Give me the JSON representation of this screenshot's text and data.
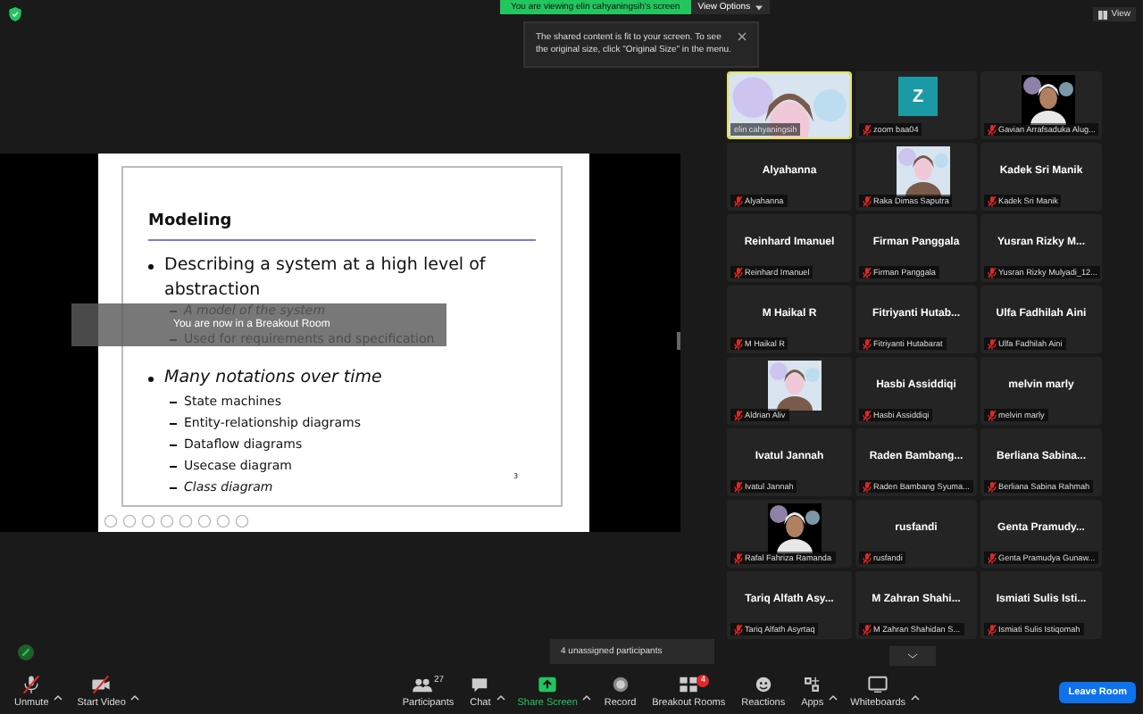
{
  "banner": {
    "text": "You are viewing elin cahyaningsih's screen",
    "button": "View Options"
  },
  "view_button": "View",
  "tooltip": "The shared content is fit to your screen. To see the original size, click \"Original Size\" in the menu.",
  "slide": {
    "title": "Modeling",
    "page": "3",
    "bullets": [
      {
        "text": "Describing a system at a high level of abstraction",
        "italic": false,
        "children": [
          {
            "text": "A model of the system",
            "italic": true
          },
          {
            "text": "Used for requirements and specification",
            "italic": false
          }
        ]
      },
      {
        "text": "Many notations over time",
        "italic": true,
        "children": [
          {
            "text": "State machines",
            "italic": false
          },
          {
            "text": "Entity-relationship diagrams",
            "italic": false
          },
          {
            "text": "Dataflow diagrams",
            "italic": false
          },
          {
            "text": "Usecase diagram",
            "italic": false
          },
          {
            "text": "Class diagram",
            "italic": true
          }
        ]
      }
    ]
  },
  "breakout_notice": "You are now in a Breakout Room",
  "tiles": [
    {
      "kind": "video",
      "label": "elin cahyaningsih",
      "muted": false,
      "speaking": true
    },
    {
      "kind": "avatar",
      "initial": "Z",
      "color": "#1b9aa5",
      "label": "zoom baa04",
      "muted": true,
      "speaking": false
    },
    {
      "label": "Gavian Arrafsaduka Alug...",
      "muted": true,
      "speaking": false
    },
    {
      "kind": "name",
      "name": "Alyahanna",
      "label": "Alyahanna",
      "muted": true,
      "speaking": false
    },
    {
      "label": "Raka Dimas Saputra",
      "muted": true,
      "speaking": false
    },
    {
      "kind": "name",
      "name": "Kadek Sri Manik",
      "label": "Kadek Sri Manik",
      "muted": true,
      "speaking": false
    },
    {
      "kind": "name",
      "name": "Reinhard Imanuel",
      "label": "Reinhard Imanuel",
      "muted": true,
      "speaking": false
    },
    {
      "kind": "name",
      "name": "Firman Panggala",
      "label": "Firman Panggala",
      "muted": true,
      "speaking": false
    },
    {
      "kind": "name",
      "name": "Yusran Rizky M...",
      "label": "Yusran Rizky Mulyadi_12...",
      "muted": true,
      "speaking": false
    },
    {
      "kind": "name",
      "name": "M Haikal R",
      "label": "M Haikal R",
      "muted": true,
      "speaking": false
    },
    {
      "kind": "name",
      "name": "Fitriyanti Hutab...",
      "label": "Fitriyanti Hutabarat",
      "muted": true,
      "speaking": false
    },
    {
      "kind": "name",
      "name": "Ulfa Fadhilah Aini",
      "label": "Ulfa Fadhilah Aini",
      "muted": true,
      "speaking": false
    },
    {
      "label": "Aldrian Aliv",
      "muted": true,
      "speaking": false
    },
    {
      "kind": "name",
      "name": "Hasbi Assiddiqi",
      "label": "Hasbi Assiddiqi",
      "muted": true,
      "speaking": false
    },
    {
      "kind": "name",
      "name": "melvin marly",
      "label": "melvin marly",
      "muted": true,
      "speaking": false
    },
    {
      "kind": "name",
      "name": "Ivatul Jannah",
      "label": "Ivatul Jannah",
      "muted": true,
      "speaking": false
    },
    {
      "kind": "name",
      "name": "Raden Bambang...",
      "label": "Raden Bambang Syuma...",
      "muted": true,
      "speaking": false
    },
    {
      "kind": "name",
      "name": "Berliana Sabina...",
      "label": "Berliana Sabina Rahmah",
      "muted": true,
      "speaking": false
    },
    {
      "label": "Rafal Fahriza Ramanda",
      "muted": true,
      "speaking": false
    },
    {
      "kind": "name",
      "name": "rusfandi",
      "label": "rusfandi",
      "muted": true,
      "speaking": false
    },
    {
      "kind": "name",
      "name": "Genta Pramudy...",
      "label": "Genta Pramudya Gunaw...",
      "muted": true,
      "speaking": false
    },
    {
      "kind": "name",
      "name": "Tariq Alfath Asy...",
      "label": "Tariq Alfath Asyrtaq",
      "muted": true,
      "speaking": false
    },
    {
      "kind": "name",
      "name": "M Zahran Shahi...",
      "label": "M Zahran Shahidan S...",
      "muted": true,
      "speaking": false
    },
    {
      "kind": "name",
      "name": "Ismiati Sulis Isti...",
      "label": "Ismiati Sulis Istiqomah",
      "muted": true,
      "speaking": false
    }
  ],
  "unassigned": "4 unassigned participants",
  "toolbar": [
    {
      "kind": "mic",
      "label": "Unmute",
      "caret": true
    },
    {
      "kind": "video",
      "label": "Start Video",
      "caret": true
    },
    {
      "kind": "participants",
      "label": "Participants",
      "count": "27",
      "caret": false
    },
    {
      "kind": "chat",
      "label": "Chat",
      "caret": true
    },
    {
      "kind": "share",
      "label": "Share Screen",
      "caret": true
    },
    {
      "kind": "record",
      "label": "Record",
      "caret": false
    },
    {
      "kind": "breakout",
      "label": "Breakout Rooms",
      "badge": "4",
      "caret": false
    },
    {
      "kind": "reactions",
      "label": "Reactions",
      "caret": false
    },
    {
      "kind": "apps",
      "label": "Apps",
      "caret": true
    },
    {
      "kind": "whiteboards",
      "label": "Whiteboards",
      "caret": true
    }
  ],
  "leave": "Leave Room"
}
